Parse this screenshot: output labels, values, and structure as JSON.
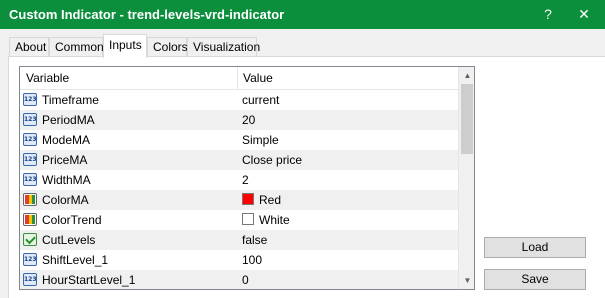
{
  "window": {
    "title": "Custom Indicator - trend-levels-vrd-indicator",
    "help_glyph": "?",
    "close_glyph": "✕"
  },
  "tabs": [
    {
      "label": "About"
    },
    {
      "label": "Common"
    },
    {
      "label": "Inputs",
      "active": true
    },
    {
      "label": "Colors"
    },
    {
      "label": "Visualization"
    }
  ],
  "grid": {
    "col_variable": "Variable",
    "col_value": "Value",
    "rows": [
      {
        "name": "Timeframe",
        "value": "current",
        "icon": "number-input-icon"
      },
      {
        "name": "PeriodMA",
        "value": "20",
        "icon": "number-input-icon"
      },
      {
        "name": "ModeMA",
        "value": "Simple",
        "icon": "number-input-icon"
      },
      {
        "name": "PriceMA",
        "value": "Close price",
        "icon": "number-input-icon"
      },
      {
        "name": "WidthMA",
        "value": "2",
        "icon": "number-input-icon"
      },
      {
        "name": "ColorMA",
        "value": "Red",
        "icon": "color-input-icon",
        "swatch": "#ff0000"
      },
      {
        "name": "ColorTrend",
        "value": "White",
        "icon": "color-input-icon",
        "swatch": "#ffffff"
      },
      {
        "name": "CutLevels",
        "value": "false",
        "icon": "bool-input-icon"
      },
      {
        "name": "ShiftLevel_1",
        "value": "100",
        "icon": "number-input-icon"
      },
      {
        "name": "HourStartLevel_1",
        "value": "0",
        "icon": "number-input-icon"
      }
    ]
  },
  "buttons": {
    "load": "Load",
    "save": "Save"
  },
  "colors": {
    "titlebar": "#0b8f3c",
    "window_bg": "#f0f0f0"
  }
}
